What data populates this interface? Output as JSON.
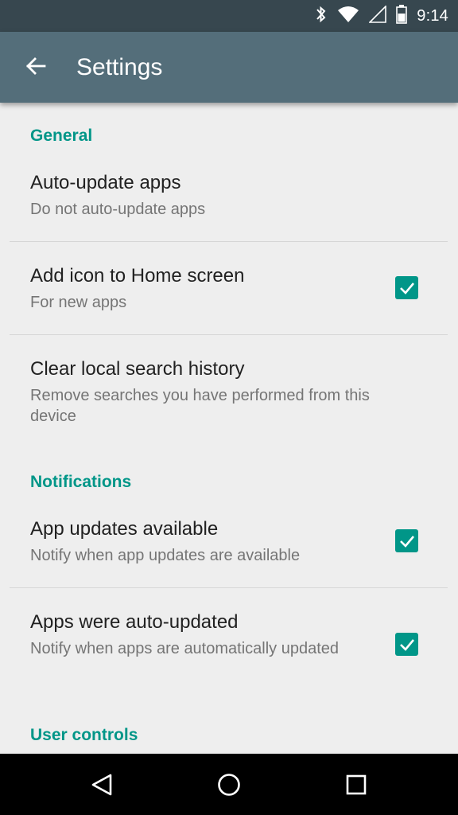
{
  "status_bar": {
    "time": "9:14",
    "icons": [
      "bluetooth-icon",
      "wifi-icon",
      "signal-icon",
      "battery-icon"
    ]
  },
  "toolbar": {
    "back_icon": "arrow-back-icon",
    "title": "Settings"
  },
  "sections": [
    {
      "header": "General",
      "items": [
        {
          "title": "Auto-update apps",
          "summary": "Do not auto-update apps",
          "checkbox": false
        },
        {
          "title": "Add icon to Home screen",
          "summary": "For new apps",
          "checkbox": true,
          "checked": true
        },
        {
          "title": "Clear local search history",
          "summary": "Remove searches you have performed from this device",
          "checkbox": false
        }
      ]
    },
    {
      "header": "Notifications",
      "items": [
        {
          "title": "App updates available",
          "summary": "Notify when app updates are available",
          "checkbox": true,
          "checked": true
        },
        {
          "title": "Apps were auto-updated",
          "summary": "Notify when apps are automatically updated",
          "checkbox": true,
          "checked": true
        }
      ]
    },
    {
      "header": "User controls",
      "items": []
    }
  ],
  "nav_bar": {
    "buttons": [
      "back-triangle-icon",
      "home-circle-icon",
      "recents-square-icon"
    ]
  },
  "colors": {
    "status_bar": "#37474f",
    "toolbar": "#546e7a",
    "accent": "#009688",
    "background": "#eeeeee"
  }
}
